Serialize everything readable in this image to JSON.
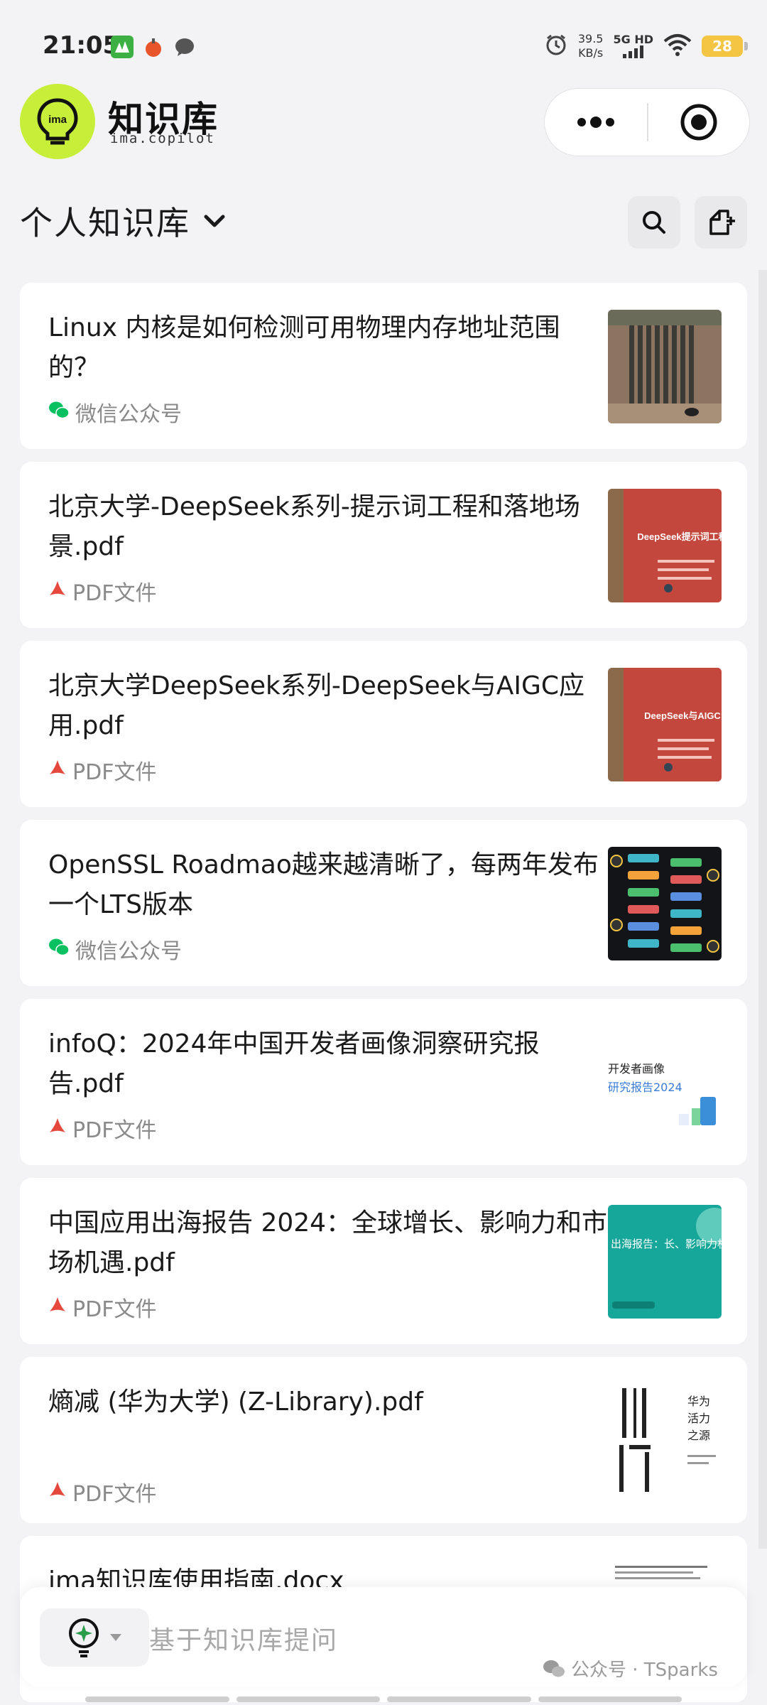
{
  "status_bar": {
    "time": "21:05",
    "net_speed_value": "39.5",
    "net_speed_unit": "KB/s",
    "network": "5G HD",
    "battery": "28"
  },
  "header": {
    "logo_text": "ima",
    "title": "知识库",
    "subtitle": "ima.copilot"
  },
  "library": {
    "title": "个人知识库"
  },
  "items": [
    {
      "title": "Linux 内核是如何检测可用物理内存地址范围的？",
      "source": "微信公众号",
      "source_type": "wechat",
      "thumb": "hardware-photo"
    },
    {
      "title": "北京大学-DeepSeek系列-提示词工程和落地场景.pdf",
      "source": "PDF文件",
      "source_type": "pdf",
      "thumb": "red-slide",
      "thumb_text": "DeepSeek提示词工程"
    },
    {
      "title": "北京大学DeepSeek系列-DeepSeek与AIGC应用.pdf",
      "source": "PDF文件",
      "source_type": "pdf",
      "thumb": "red-slide",
      "thumb_text": "DeepSeek与AIGC"
    },
    {
      "title": "OpenSSL Roadmao越来越清晰了，每两年发布一个LTS版本",
      "source": "微信公众号",
      "source_type": "wechat",
      "thumb": "roadmap"
    },
    {
      "title": "infoQ：2024年中国开发者画像洞察研究报告.pdf",
      "source": "PDF文件",
      "source_type": "pdf",
      "thumb": "infoq",
      "thumb_text_1": "开发者画像",
      "thumb_text_2": "研究报告2024"
    },
    {
      "title": "中国应用出海报告 2024：全球增长、影响力和市场机遇.pdf",
      "source": "PDF文件",
      "source_type": "pdf",
      "thumb": "teal",
      "thumb_text": "出海报告：长、影响力机遇"
    },
    {
      "title": "熵减 (华为大学) (Z-Library).pdf",
      "source": "PDF文件",
      "source_type": "pdf",
      "thumb": "book",
      "thumb_text": "华为活力之源"
    },
    {
      "title": "ima知识库使用指南.docx",
      "source": "",
      "source_type": "docx",
      "thumb": "doc"
    }
  ],
  "ask_bar": {
    "placeholder": "基于知识库提问"
  },
  "watermark": "公众号 · TSparks",
  "colors": {
    "background": "#f3f3f5",
    "brand_lime": "#c7ef3a",
    "wechat_green": "#07c160",
    "pdf_red": "#e5483c"
  }
}
